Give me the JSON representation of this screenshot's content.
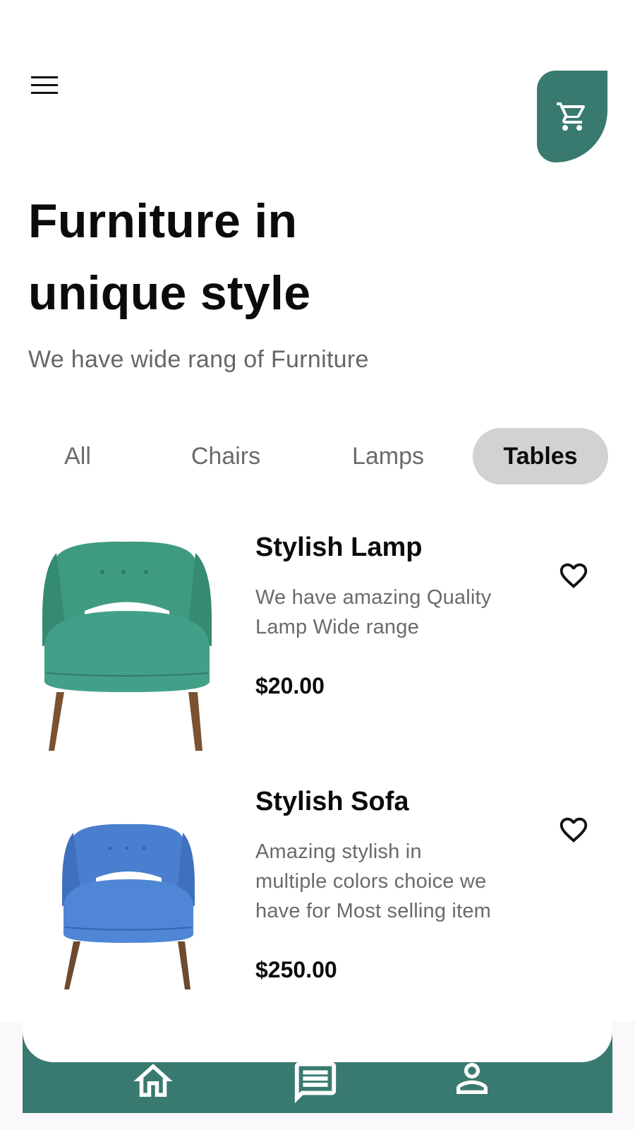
{
  "header": {
    "menu_icon": "hamburger-menu-icon",
    "cart_icon": "shopping-cart-icon",
    "accent_color": "#397a70"
  },
  "hero": {
    "title_line1": "Furniture in",
    "title_line2": "unique style",
    "subtitle": "We have wide rang of Furniture"
  },
  "tabs": [
    {
      "label": "All",
      "active": false
    },
    {
      "label": "Chairs",
      "active": false
    },
    {
      "label": "Lamps",
      "active": false
    },
    {
      "label": "Tables",
      "active": true
    }
  ],
  "products": [
    {
      "name": "Stylish Lamp",
      "description_line1": "We have amazing Quality",
      "description_line2": "Lamp Wide range",
      "price": "$20.00",
      "image": "green-armchair",
      "image_color": "#3f9a82",
      "favorite_icon": "heart-outline-icon"
    },
    {
      "name": "Stylish Sofa",
      "description_line1": "Amazing stylish in",
      "description_line2": "multiple colors choice we",
      "description_line3": "have for Most selling item",
      "price": "$250.00",
      "image": "blue-armchair",
      "image_color": "#4a7fcf",
      "favorite_icon": "heart-outline-icon"
    }
  ],
  "bottom_nav": {
    "items": [
      {
        "icon": "home-icon"
      },
      {
        "icon": "chat-icon"
      },
      {
        "icon": "profile-icon"
      }
    ]
  }
}
